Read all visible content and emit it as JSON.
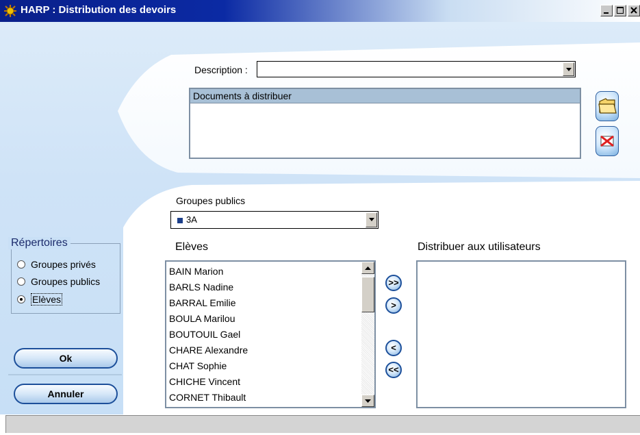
{
  "window": {
    "title": "HARP : Distribution des devoirs"
  },
  "description": {
    "label": "Description :",
    "value": ""
  },
  "documents": {
    "header": "Documents à distribuer",
    "items": []
  },
  "groups": {
    "label": "Groupes publics",
    "selected": "3A"
  },
  "students": {
    "label": "Elèves",
    "items": [
      "BAIN Marion",
      "BARLS Nadine",
      "BARRAL Emilie",
      "BOULA Marilou",
      "BOUTOUIL Gael",
      "CHARE Alexandre",
      "CHAT Sophie",
      "CHICHE Vincent",
      "CORNET Thibault"
    ]
  },
  "recipients": {
    "label": "Distribuer aux utilisateurs",
    "items": []
  },
  "transfer_buttons": {
    "add_all": ">>",
    "add_one": ">",
    "remove_one": "<",
    "remove_all": "<<"
  },
  "repertoires": {
    "title": "Répertoires",
    "options": [
      "Groupes privés",
      "Groupes publics",
      "Elèves"
    ],
    "selected": "Elèves"
  },
  "buttons": {
    "ok": "Ok",
    "cancel": "Annuler"
  },
  "colors": {
    "title_bar": "#0a1f8a",
    "background": "#cfe3f7",
    "button_border": "#1c4f9a"
  }
}
